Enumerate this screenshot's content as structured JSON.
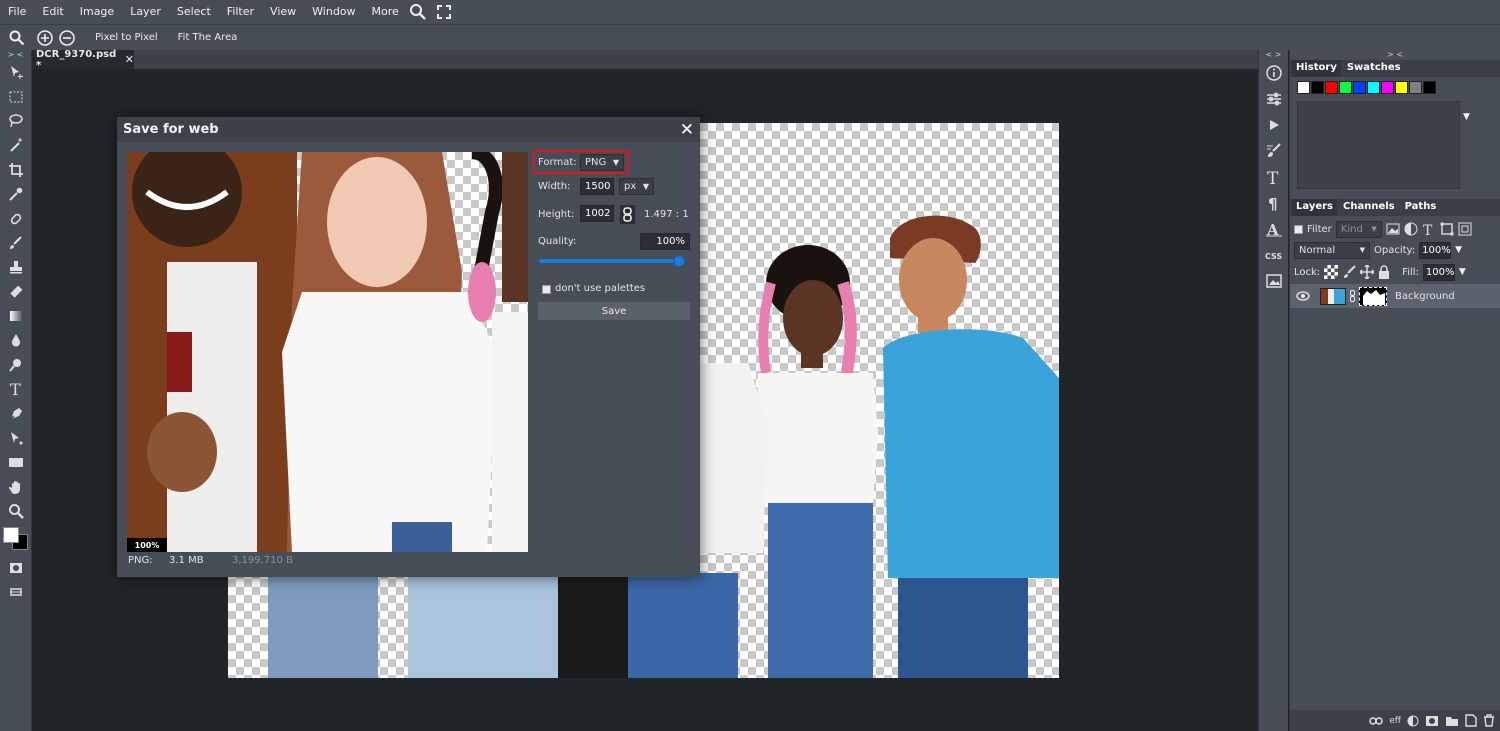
{
  "menu": {
    "items": [
      "File",
      "Edit",
      "Image",
      "Layer",
      "Select",
      "Filter",
      "View",
      "Window",
      "More"
    ]
  },
  "options": {
    "pixel_to_pixel": "Pixel to Pixel",
    "fit_area": "Fit The Area"
  },
  "document": {
    "tab_title": "DCR_9370.psd *",
    "close": "✕"
  },
  "panel_toggle": {
    "left": "> <",
    "right_icons": "< >",
    "right_panels": "> <"
  },
  "history_panel": {
    "tabs": [
      "History",
      "Swatches"
    ],
    "swatch_colors": [
      "#ffffff",
      "#000000",
      "#ff0000",
      "#00ff40",
      "#0040ff",
      "#00ffff",
      "#ff00ff",
      "#ffff00",
      "#808080",
      "#000000"
    ]
  },
  "layers_panel": {
    "tabs": [
      "Layers",
      "Channels",
      "Paths"
    ],
    "filter_label": "Filter",
    "kind_label": "Kind",
    "blend_mode": "Normal",
    "opacity_label": "Opacity:",
    "opacity_value": "100%",
    "lock_label": "Lock:",
    "fill_label": "Fill:",
    "fill_value": "100%",
    "layer_name": "Background",
    "footer_eff": "eff"
  },
  "dialog": {
    "title": "Save for web",
    "close": "✕",
    "format_label": "Format:",
    "format_value": "PNG",
    "width_label": "Width:",
    "width_value": "1500",
    "unit": "px",
    "height_label": "Height:",
    "height_value": "1002",
    "ratio": "1.497 : 1",
    "quality_label": "Quality:",
    "quality_value": "100%",
    "quality_fraction": 1.0,
    "palette_label": "don't use palettes",
    "save_label": "Save",
    "zoom_badge": "100%",
    "footer_format": "PNG:",
    "footer_size": "3.1 MB",
    "footer_bytes": "3,199,710 B"
  },
  "colors": {
    "accent_red": "#e0141e",
    "slider_blue": "#1e7bd8",
    "bg_dark": "#222528",
    "panel": "#474d57"
  }
}
